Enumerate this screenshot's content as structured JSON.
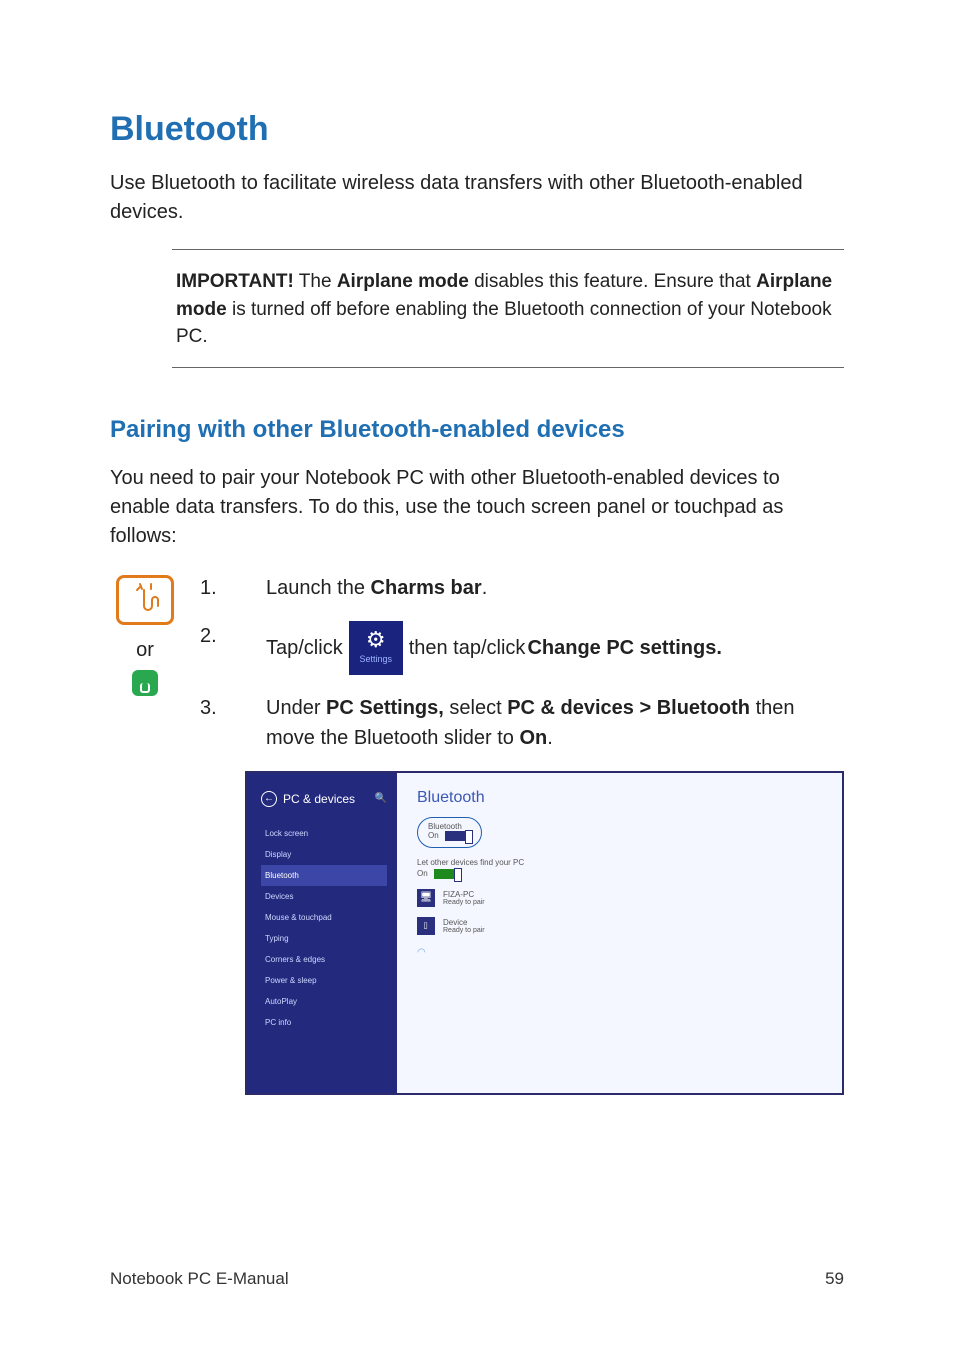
{
  "footer": {
    "left": "Notebook PC E-Manual",
    "page": "59"
  },
  "h1": "Bluetooth",
  "intro": "Use Bluetooth to facilitate wireless data transfers with other Bluetooth-enabled devices.",
  "important": {
    "label": "IMPORTANT!",
    "seg1": " The ",
    "b1": "Airplane mode",
    "seg2": " disables this feature. Ensure that ",
    "b2": "Airplane mode",
    "seg3": " is turned off before enabling the Bluetooth connection of your Notebook PC."
  },
  "h2": "Pairing with other Bluetooth-enabled devices",
  "pairing_intro": "You need to pair your Notebook PC with other Bluetooth-enabled devices to enable data transfers. To do this, use the touch screen panel or touchpad as follows:",
  "or_text": "or",
  "steps": {
    "s1": {
      "text_a": "Launch the ",
      "bold": "Charms bar",
      "text_b": "."
    },
    "s2": {
      "text_a": "Tap/click ",
      "tile_label": "Settings",
      "text_b": " then tap/click ",
      "bold": "Change PC settings."
    },
    "s3": {
      "text_a": "Under ",
      "b1": "PC Settings,",
      "text_b": " select ",
      "b2": "PC & devices > Bluetooth",
      "text_c": " then move the Bluetooth slider to ",
      "b3": "On",
      "text_d": "."
    }
  },
  "screenshot": {
    "back_title": "PC & devices",
    "nav": [
      "Lock screen",
      "Display",
      "Bluetooth",
      "Devices",
      "Mouse & touchpad",
      "Typing",
      "Corners & edges",
      "Power & sleep",
      "AutoPlay",
      "PC info"
    ],
    "nav_active_index": 2,
    "right_title": "Bluetooth",
    "callout_label": "Bluetooth",
    "callout_state": "On",
    "let_find": "Let other devices find your PC",
    "let_find_state": "On",
    "dev1": {
      "name": "FIZA-PC",
      "state": "Ready to pair"
    },
    "dev2": {
      "name": "Device",
      "state": "Ready to pair"
    }
  }
}
